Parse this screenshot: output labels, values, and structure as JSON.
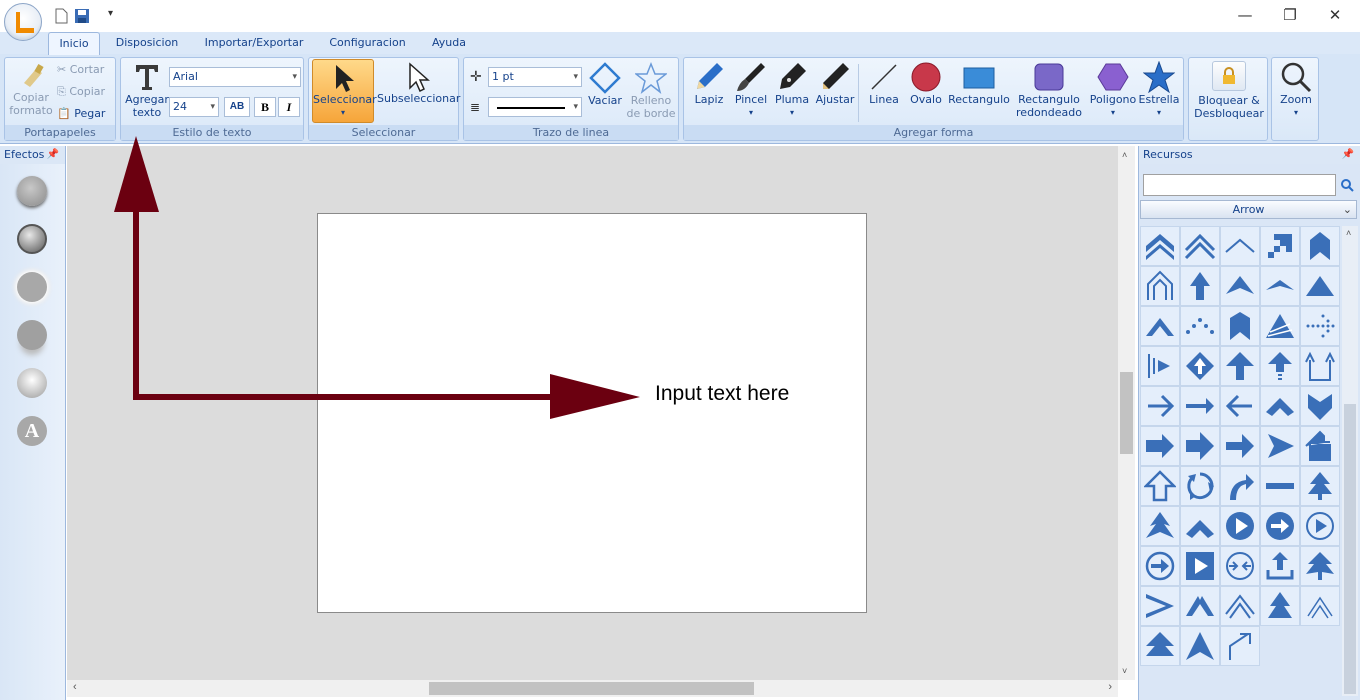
{
  "app": {
    "accent": "#f08a00",
    "brand_icon": "app-logo-icon"
  },
  "tabs": [
    "Inicio",
    "Disposicion",
    "Importar/Exportar",
    "Configuracion",
    "Ayuda"
  ],
  "ribbon": {
    "portapapeles": {
      "label": "Portapapeles",
      "copiar_formato": "Copiar formato",
      "cortar": "Cortar",
      "copiar": "Copiar",
      "pegar": "Pegar"
    },
    "estilo": {
      "label": "Estilo de texto",
      "agregar_texto": "Agregar texto",
      "font": "Arial",
      "size": "24",
      "bold": "B",
      "italic": "I",
      "spacing": "AB"
    },
    "seleccionar": {
      "label": "Seleccionar",
      "seleccionar": "Seleccionar",
      "subseleccionar": "Subseleccionar"
    },
    "trazo": {
      "label": "Trazo de linea",
      "width": "1 pt",
      "vaciar": "Vaciar",
      "relleno": "Relleno de borde"
    },
    "forma": {
      "label": "Agregar forma",
      "lapiz": "Lapiz",
      "pincel": "Pincel",
      "pluma": "Pluma",
      "ajustar": "Ajustar",
      "linea": "Linea",
      "ovalo": "Ovalo",
      "rectangulo": "Rectangulo",
      "rect_redondeado": "Rectangulo redondeado",
      "poligono": "Poligono",
      "estrella": "Estrella"
    },
    "bloquear": "Bloquear & Desbloquear",
    "zoom": "Zoom"
  },
  "left_panel": {
    "title": "Efectos"
  },
  "right_panel": {
    "title": "Recursos",
    "search_value": "",
    "category": "Arrow"
  },
  "canvas": {
    "text": "Input text here",
    "arrow_color": "#6b0010"
  }
}
